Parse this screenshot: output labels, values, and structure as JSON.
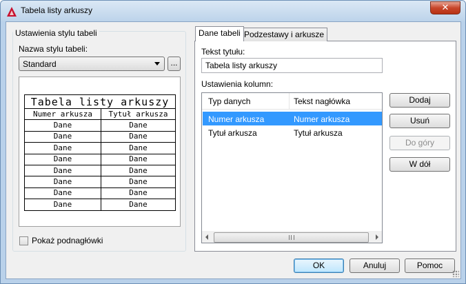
{
  "window": {
    "title": "Tabela listy arkuszy",
    "close_glyph": "✕"
  },
  "left": {
    "group_legend": "Ustawienia stylu tabeli",
    "style_label": "Nazwa stylu tabeli:",
    "style_value": "Standard",
    "browse_label": "...",
    "preview": {
      "title": "Tabela listy arkuszy",
      "headers": [
        "Numer arkusza",
        "Tytuł arkusza"
      ],
      "rows": [
        [
          "Dane",
          "Dane"
        ],
        [
          "Dane",
          "Dane"
        ],
        [
          "Dane",
          "Dane"
        ],
        [
          "Dane",
          "Dane"
        ],
        [
          "Dane",
          "Dane"
        ],
        [
          "Dane",
          "Dane"
        ],
        [
          "Dane",
          "Dane"
        ],
        [
          "Dane",
          "Dane"
        ]
      ]
    },
    "show_subheaders_label": "Pokaż podnagłówki",
    "show_subheaders_checked": false
  },
  "tabs": [
    {
      "label": "Dane tabeli",
      "active": true
    },
    {
      "label": "Podzestawy i arkusze",
      "active": false
    }
  ],
  "table_data": {
    "title_label": "Tekst tytułu:",
    "title_value": "Tabela listy arkuszy",
    "columns_label": "Ustawienia kolumn:",
    "list_headers": [
      "Typ danych",
      "Tekst nagłówka"
    ],
    "list_rows": [
      {
        "type": "Numer arkusza",
        "header": "Numer arkusza",
        "selected": true
      },
      {
        "type": "Tytuł arkusza",
        "header": "Tytuł arkusza",
        "selected": false
      }
    ]
  },
  "side_buttons": {
    "add": "Dodaj",
    "remove": "Usuń",
    "up": "Do góry",
    "down": "W dół"
  },
  "footer": {
    "ok": "OK",
    "cancel": "Anuluj",
    "help": "Pomoc"
  },
  "colors": {
    "selection": "#3399ff",
    "app_icon": "#c8102e"
  }
}
